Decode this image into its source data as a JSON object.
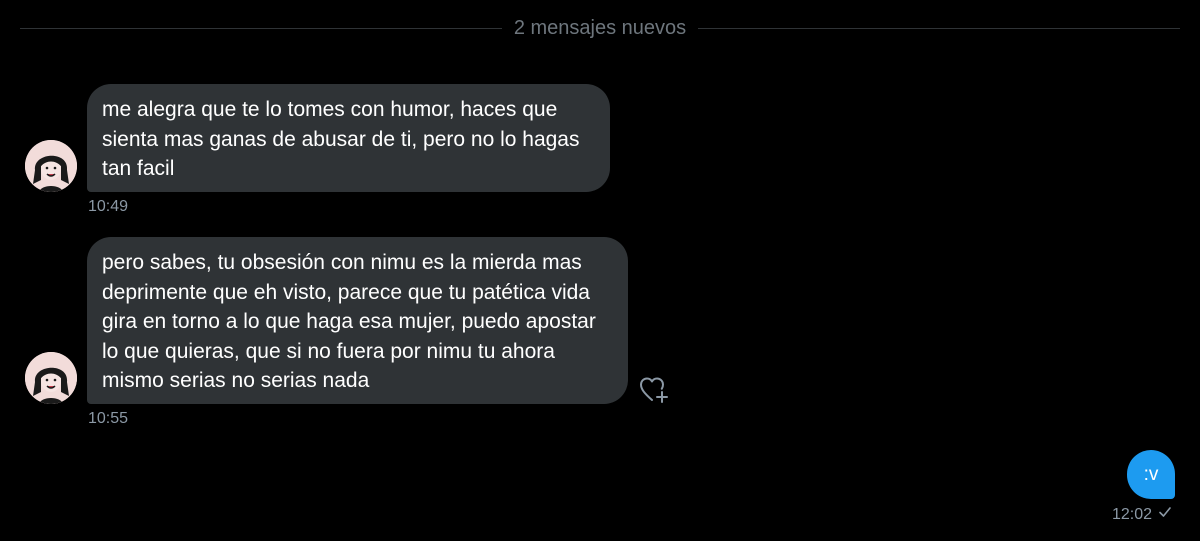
{
  "divider": {
    "label": "2 mensajes nuevos"
  },
  "messages": [
    {
      "text": "me alegra que te lo tomes con humor, haces que sienta mas ganas de abusar de ti, pero no lo hagas tan facil",
      "time": "10:49"
    },
    {
      "text": "pero sabes, tu obsesión con nimu es la mierda mas deprimente que eh visto, parece que tu patética vida gira en torno a lo que haga esa mujer, puedo apostar lo que quieras, que si no fuera por nimu tu ahora mismo serias no serias nada",
      "time": "10:55"
    }
  ],
  "sent": {
    "text": ":v",
    "time": "12:02",
    "status_icon": "check-icon"
  },
  "colors": {
    "background": "#000000",
    "received_bubble": "#2f3336",
    "sent_bubble": "#1d9bf0",
    "muted_text": "#8b98a5"
  },
  "icons": {
    "avatar": "avatar",
    "react": "heart-plus-icon",
    "read": "check-icon"
  }
}
